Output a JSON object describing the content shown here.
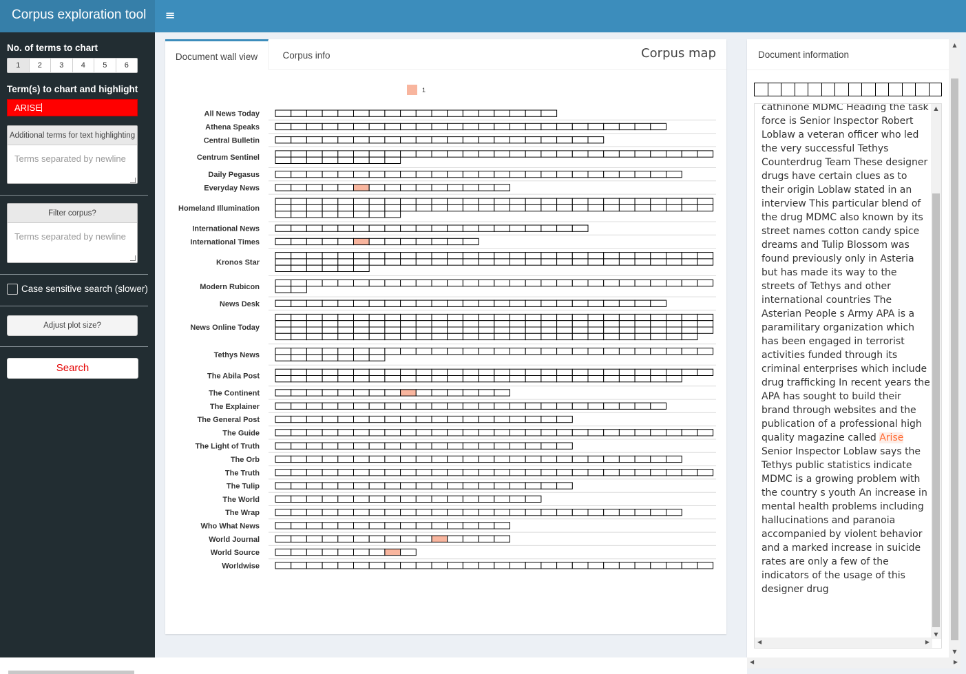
{
  "header": {
    "app_title": "Corpus exploration tool",
    "menu_icon": "hamburger-icon",
    "menu_glyph": "≡"
  },
  "sidebar": {
    "num_terms_label": "No. of terms to chart",
    "num_terms_options": [
      "1",
      "2",
      "3",
      "4",
      "5",
      "6"
    ],
    "num_terms_selected": "1",
    "terms_label": "Term(s) to chart and highlight",
    "terms_value": "ARISE",
    "terms_color": "#ff0000",
    "additional_terms_header": "Additional terms for text highlighting",
    "additional_terms_placeholder": "Terms separated by newline",
    "filter_header": "Filter corpus?",
    "filter_placeholder": "Terms separated by newline",
    "case_sensitive_label": "Case sensitive search (slower)",
    "case_sensitive_checked": false,
    "adjust_button": "Adjust plot size?",
    "search_button": "Search"
  },
  "main": {
    "tabs": [
      {
        "label": "Document wall view",
        "active": true
      },
      {
        "label": "Corpus info",
        "active": false
      }
    ],
    "title": "Corpus map"
  },
  "chart_data": {
    "type": "heatmap",
    "legend": [
      {
        "label": "1",
        "color": "#f8b59e"
      }
    ],
    "rows": [
      {
        "name": "All News Today",
        "docs": 18,
        "hits": []
      },
      {
        "name": "Athena Speaks",
        "docs": 25,
        "hits": []
      },
      {
        "name": "Central Bulletin",
        "docs": 21,
        "hits": []
      },
      {
        "name": "Centrum Sentinel",
        "docs": 36,
        "hits": []
      },
      {
        "name": "Daily Pegasus",
        "docs": 26,
        "hits": []
      },
      {
        "name": "Everyday News",
        "docs": 15,
        "hits": [
          5
        ]
      },
      {
        "name": "Homeland Illumination",
        "docs": 64,
        "hits": []
      },
      {
        "name": "International News",
        "docs": 20,
        "hits": []
      },
      {
        "name": "International Times",
        "docs": 13,
        "hits": [
          5
        ]
      },
      {
        "name": "Kronos Star",
        "docs": 62,
        "hits": []
      },
      {
        "name": "Modern Rubicon",
        "docs": 30,
        "hits": []
      },
      {
        "name": "News Desk",
        "docs": 25,
        "hits": []
      },
      {
        "name": "News Online Today",
        "docs": 111,
        "hits": []
      },
      {
        "name": "Tethys News",
        "docs": 35,
        "hits": []
      },
      {
        "name": "The Abila Post",
        "docs": 54,
        "hits": []
      },
      {
        "name": "The Continent",
        "docs": 15,
        "hits": [
          8
        ]
      },
      {
        "name": "The Explainer",
        "docs": 25,
        "hits": []
      },
      {
        "name": "The General Post",
        "docs": 19,
        "hits": []
      },
      {
        "name": "The Guide",
        "docs": 28,
        "hits": []
      },
      {
        "name": "The Light of Truth",
        "docs": 19,
        "hits": []
      },
      {
        "name": "The Orb",
        "docs": 26,
        "hits": []
      },
      {
        "name": "The Truth",
        "docs": 28,
        "hits": []
      },
      {
        "name": "The Tulip",
        "docs": 19,
        "hits": []
      },
      {
        "name": "The World",
        "docs": 17,
        "hits": []
      },
      {
        "name": "The Wrap",
        "docs": 26,
        "hits": []
      },
      {
        "name": "Who What News",
        "docs": 15,
        "hits": []
      },
      {
        "name": "World Journal",
        "docs": 15,
        "hits": [
          10
        ]
      },
      {
        "name": "World Source",
        "docs": 9,
        "hits": [
          7
        ]
      },
      {
        "name": "Worldwise",
        "docs": 28,
        "hits": []
      }
    ]
  },
  "info": {
    "title": "Document information",
    "strip_cells": 14,
    "text_before": "cathinone MDMC Heading the task force is Senior Inspector Robert Loblaw a veteran officer who led the very successful Tethys Counterdrug Team These designer drugs have certain clues as to their origin Loblaw stated in an interview This particular blend of the drug MDMC also known by its street names cotton candy spice dreams and Tulip Blossom was found previously only in Asteria but has made its way to the streets of Tethys and other international countries The Asterian People s Army APA is a paramilitary organization which has been engaged in terrorist activities funded through its criminal enterprises which include drug trafficking In recent years the APA has sought to build their brand through websites and the publication of a professional high quality magazine called ",
    "highlight_term": "Arise",
    "text_after": " Senior Inspector Loblaw says the Tethys public statistics indicate MDMC is a growing problem with the country s youth An increase in mental health problems including hallucinations and paranoia accompanied by violent behavior and a marked increase in suicide rates are only a few of the indicators of the usage of this designer drug",
    "highlight_color": "#ff6a33"
  }
}
